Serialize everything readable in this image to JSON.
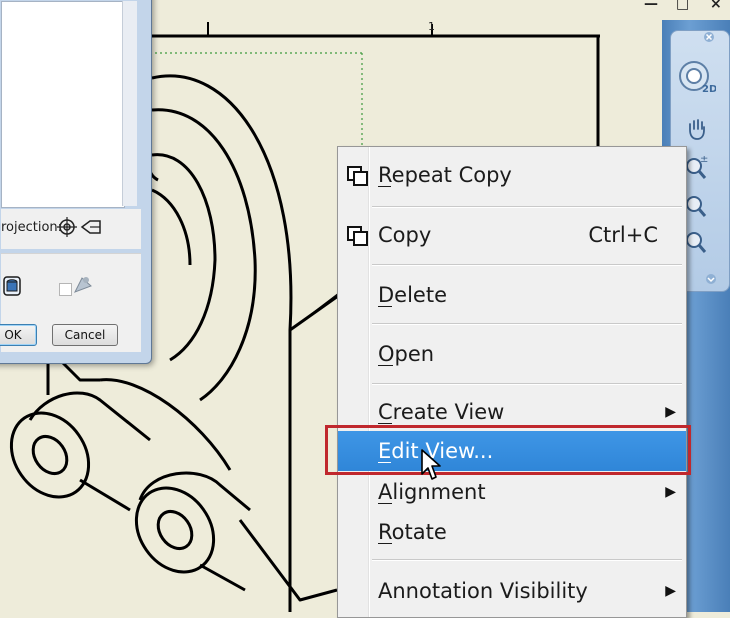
{
  "dialog": {
    "projection_label": "rojection:",
    "ok_label": "OK",
    "cancel_label": "Cancel"
  },
  "context_menu": {
    "items": [
      {
        "label": "Repeat Copy",
        "mnemonic": "R",
        "icon": "copy-icon"
      },
      {
        "label": "Copy",
        "shortcut": "Ctrl+C",
        "icon": "copy-icon"
      },
      {
        "label": "Delete",
        "mnemonic": "D"
      },
      {
        "label": "Open",
        "mnemonic": "O"
      },
      {
        "label": "Create View",
        "mnemonic": "C",
        "submenu": true
      },
      {
        "label": "Edit View...",
        "mnemonic": "E",
        "highlighted": true
      },
      {
        "label": "Alignment",
        "mnemonic": "A",
        "submenu": true
      },
      {
        "label": "Rotate",
        "mnemonic": "R"
      },
      {
        "label": "Annotation Visibility",
        "submenu": true
      }
    ]
  },
  "drawing": {
    "tick_label": "1"
  },
  "navigation_bar": {
    "icons": [
      "steering-wheel-icon",
      "pan-icon",
      "zoom-icon",
      "zoom-window-icon",
      "orbit-icon"
    ]
  },
  "colors": {
    "canvas_background": "#eeecda",
    "menu_highlight": "#3f96e6",
    "callout_border": "#c0282d",
    "dialog_frame": "#c3d5ea",
    "navbar_blue": "#4a7fb8"
  }
}
